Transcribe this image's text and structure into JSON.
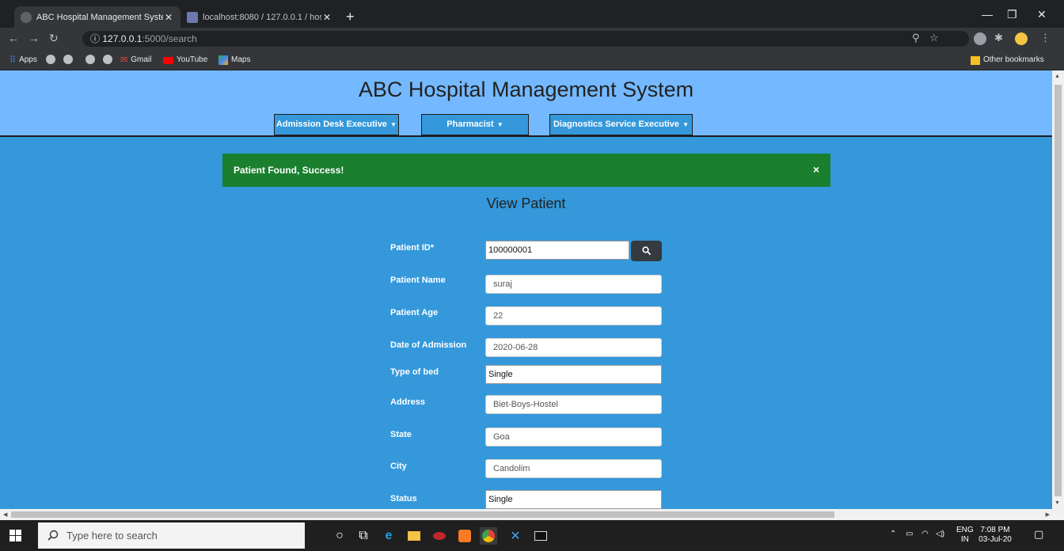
{
  "browser": {
    "tabs": [
      {
        "title": "ABC Hospital Management Syste",
        "active": true
      },
      {
        "title": "localhost:8080 / 127.0.0.1 / hospi",
        "active": false
      }
    ],
    "url_host": "127.0.0.1",
    "url_path": ":5000/search",
    "bookmarks": {
      "apps": "Apps",
      "gmail": "Gmail",
      "youtube": "YouTube",
      "maps": "Maps",
      "other": "Other bookmarks"
    }
  },
  "header": {
    "title": "ABC Hospital Management System",
    "menus": [
      "Admission Desk Executive",
      "Pharmacist",
      "Diagnostics Service Executive"
    ]
  },
  "alert": {
    "message": "Patient Found, Success!",
    "close": "×",
    "color": "#1a7f2e"
  },
  "form": {
    "title": "View Patient",
    "fields": [
      {
        "label": "Patient ID*",
        "value": "100000001"
      },
      {
        "label": "Patient Name",
        "value": "suraj"
      },
      {
        "label": "Patient Age",
        "value": "22"
      },
      {
        "label": "Date of Admission",
        "value": "2020-06-28"
      },
      {
        "label": "Type of bed",
        "value": "Single"
      },
      {
        "label": "Address",
        "value": "Biet-Boys-Hostel"
      },
      {
        "label": "State",
        "value": "Goa"
      },
      {
        "label": "City",
        "value": "Candolim"
      },
      {
        "label": "Status",
        "value": "Single"
      }
    ]
  },
  "taskbar": {
    "search_placeholder": "Type here to search",
    "lang": "ENG",
    "region": "IN",
    "time": "7:08 PM",
    "date": "03-Jul-20"
  },
  "colors": {
    "page_bg": "#3498db",
    "header_bg": "#74b9ff",
    "search_button": "#343a40"
  }
}
